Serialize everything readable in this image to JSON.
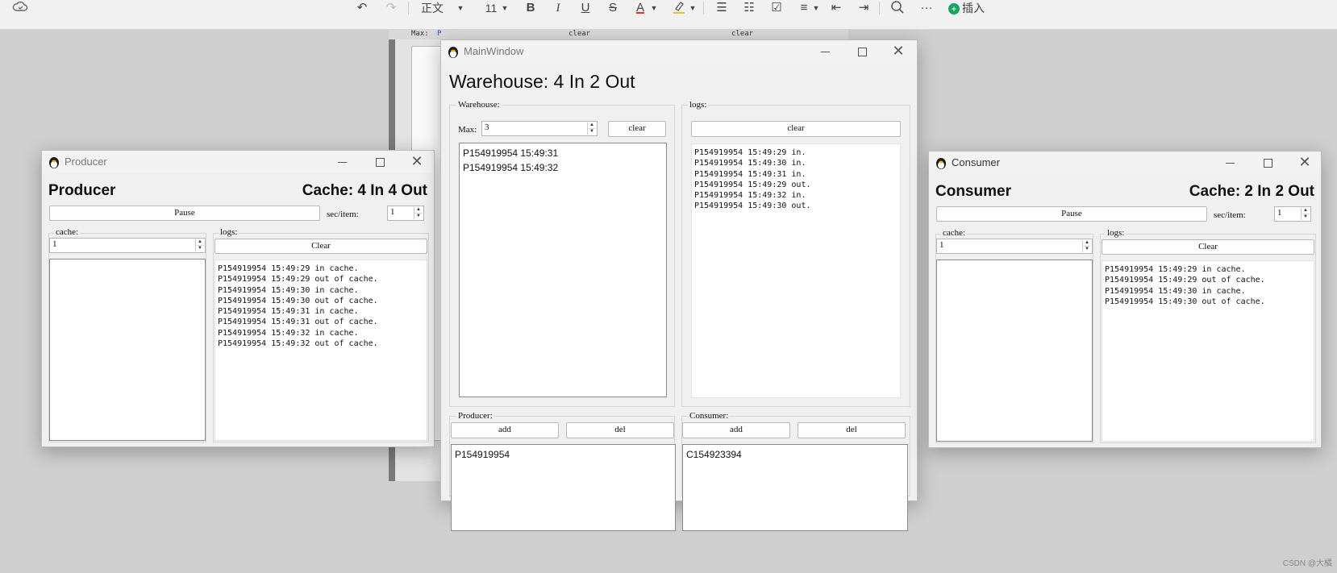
{
  "toolbar": {
    "style_label": "正文",
    "font_size": "11",
    "bold": "B",
    "italic": "I",
    "underline": "U",
    "strike": "S",
    "font_color": "A",
    "insert_label": "插入",
    "more": "···"
  },
  "background_doc": {
    "max_label": "Max:",
    "max_value": "P",
    "clear_1": "clear",
    "clear_2": "clear"
  },
  "producer": {
    "window_title": "Producer",
    "heading": "Producer",
    "cache_status": "Cache: 4 In 4 Out",
    "pause_label": "Pause",
    "sec_label": "sec/item:",
    "sec_value": "1",
    "cache_title": "cache:",
    "cache_value": "1",
    "logs_title": "logs:",
    "clear_label": "Clear",
    "logs": [
      "P154919954 15:49:29 in cache.",
      "P154919954 15:49:29 out of cache.",
      "P154919954 15:49:30 in cache.",
      "P154919954 15:49:30 out of cache.",
      "P154919954 15:49:31 in cache.",
      "P154919954 15:49:31 out of cache.",
      "P154919954 15:49:32 in cache.",
      "P154919954 15:49:32 out of cache."
    ]
  },
  "main": {
    "window_title": "MainWindow",
    "heading": "Warehouse: 4 In 2 Out",
    "warehouse_title": "Warehouse:",
    "max_label": "Max:",
    "max_value": "3",
    "clear_label": "clear",
    "warehouse_items": [
      "P154919954 15:49:31",
      "P154919954 15:49:32"
    ],
    "logs_title": "logs:",
    "logs_clear_label": "clear",
    "logs": [
      "P154919954 15:49:29 in.",
      "P154919954 15:49:30 in.",
      "P154919954 15:49:31 in.",
      "P154919954 15:49:29 out.",
      "P154919954 15:49:32 in.",
      "P154919954 15:49:30 out."
    ],
    "producer_title": "Producer:",
    "producer_add": "add",
    "producer_del": "del",
    "producers": [
      "P154919954"
    ],
    "consumer_title": "Consumer:",
    "consumer_add": "add",
    "consumer_del": "del",
    "consumers": [
      "C154923394"
    ]
  },
  "consumer": {
    "window_title": "Consumer",
    "heading": "Consumer",
    "cache_status": "Cache: 2 In 2 Out",
    "pause_label": "Pause",
    "sec_label": "sec/item:",
    "sec_value": "1",
    "cache_title": "cache:",
    "cache_value": "1",
    "logs_title": "logs:",
    "clear_label": "Clear",
    "logs": [
      "P154919954 15:49:29 in cache.",
      "P154919954 15:49:29 out of cache.",
      "P154919954 15:49:30 in cache.",
      "P154919954 15:49:30 out of cache."
    ]
  },
  "watermark": "CSDN @大橘"
}
